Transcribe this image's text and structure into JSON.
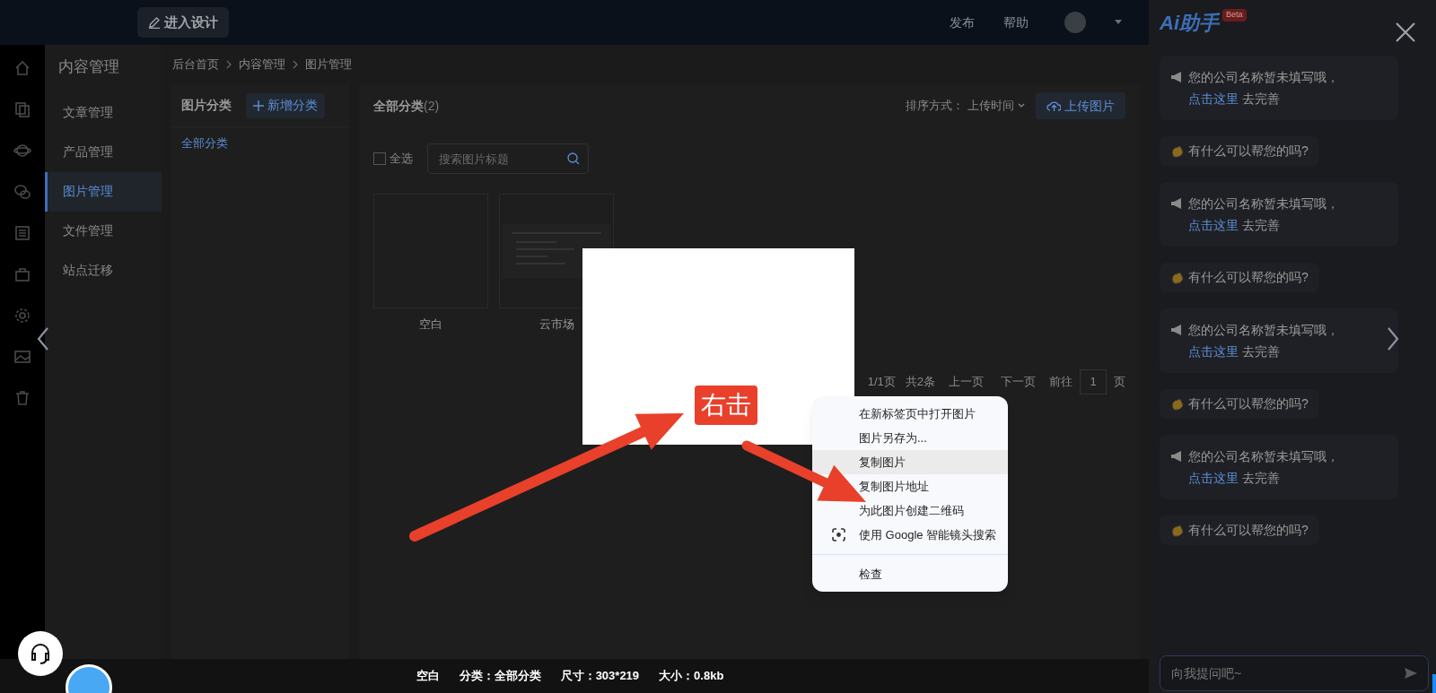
{
  "top_bar": {
    "design_button": "进入设计",
    "links": [
      "发布",
      "帮助"
    ]
  },
  "sidebar": {
    "title": "内容管理",
    "items": [
      {
        "label": "文章管理",
        "selected": false
      },
      {
        "label": "产品管理",
        "selected": false
      },
      {
        "label": "图片管理",
        "selected": true
      },
      {
        "label": "文件管理",
        "selected": false
      },
      {
        "label": "站点迁移",
        "selected": false
      }
    ]
  },
  "breadcrumb": [
    "后台首页",
    "内容管理",
    "图片管理"
  ],
  "category_panel": {
    "title": "图片分类",
    "add_button": "新增分类",
    "items": [
      {
        "label": "全部分类",
        "selected": true
      }
    ]
  },
  "gallery": {
    "title": "全部分类",
    "count": "(2)",
    "sort_label": "排序方式：",
    "sort_value": "上传时间",
    "upload_button": "上传图片",
    "select_all": {
      "label": "全选",
      "checked": false
    },
    "search": {
      "placeholder": "搜索图片标题"
    },
    "images": [
      {
        "kind": "blank",
        "caption": "空白"
      },
      {
        "kind": "screenshot",
        "caption": "云市场"
      }
    ],
    "pagination": {
      "pages": "1/1页",
      "total": "共2条",
      "prev": "上一页",
      "next": "下一页",
      "goto": "前往",
      "page": "1",
      "unit": "页"
    }
  },
  "ai_panel": {
    "title": "Ai助手",
    "badge": "Beta",
    "messages": [
      {
        "kind": "notice",
        "text": "您的公司名称暂未填写哦，",
        "link": "点击这里",
        "after": "去完善"
      },
      {
        "kind": "greeting",
        "text": "有什么可以帮您的吗?"
      },
      {
        "kind": "notice",
        "text": "您的公司名称暂未填写哦，",
        "link": "点击这里",
        "after": "去完善"
      },
      {
        "kind": "greeting",
        "text": "有什么可以帮您的吗?"
      },
      {
        "kind": "notice",
        "text": "您的公司名称暂未填写哦，",
        "link": "点击这里",
        "after": "去完善"
      },
      {
        "kind": "greeting",
        "text": "有什么可以帮您的吗?"
      },
      {
        "kind": "notice",
        "text": "您的公司名称暂未填写哦，",
        "link": "点击这里",
        "after": "去完善"
      },
      {
        "kind": "greeting",
        "text": "有什么可以帮您的吗?"
      }
    ],
    "input": {
      "placeholder": "向我提问吧~"
    }
  },
  "preview": {
    "annotation": "右击",
    "context_menu": [
      [
        {
          "label": "在新标签页中打开图片",
          "kind": "plain",
          "highlighted": false
        },
        {
          "label": "图片另存为...",
          "kind": "plain",
          "highlighted": false
        },
        {
          "label": "复制图片",
          "kind": "plain",
          "highlighted": true
        },
        {
          "label": "复制图片地址",
          "kind": "plain",
          "highlighted": false
        },
        {
          "label": "为此图片创建二维码",
          "kind": "plain",
          "highlighted": false
        },
        {
          "label": "使用 Google 智能镜头搜索",
          "kind": "lens",
          "highlighted": false
        }
      ],
      [
        {
          "label": "检查",
          "kind": "plain",
          "highlighted": false
        }
      ]
    ],
    "info": [
      "空白",
      "分类：全部分类",
      "尺寸：303*219",
      "大小：0.8kb"
    ]
  }
}
